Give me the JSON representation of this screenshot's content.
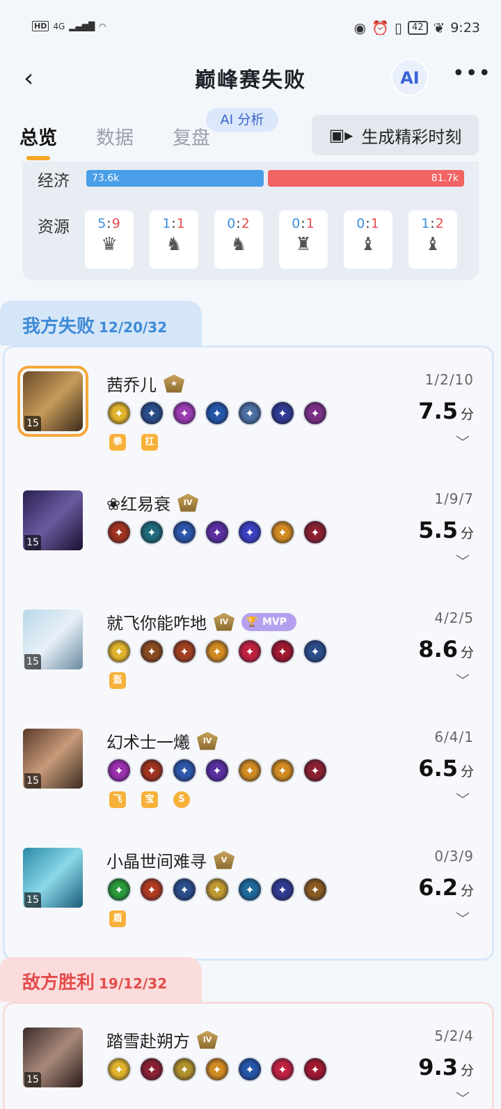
{
  "status": {
    "hd": "HD",
    "network": "4G",
    "battery": "42",
    "time": "9:23"
  },
  "header": {
    "title": "巅峰赛失败",
    "ai_label": "AI"
  },
  "tabs": [
    {
      "label": "总览"
    },
    {
      "label": "数据"
    },
    {
      "label": "复盘"
    }
  ],
  "ai_pill": "AI 分析",
  "highlight_button": "生成精彩时刻",
  "stats": {
    "economy_label": "经济",
    "resource_label": "资源",
    "our_economy": "73.6k",
    "enemy_economy": "81.7k",
    "resources": [
      {
        "ours": "5",
        "theirs": "9",
        "icon": "tyrant-icon"
      },
      {
        "ours": "1",
        "theirs": "1",
        "icon": "dragon-icon"
      },
      {
        "ours": "0",
        "theirs": "2",
        "icon": "storm-dragon-icon"
      },
      {
        "ours": "0",
        "theirs": "1",
        "icon": "overlord-icon"
      },
      {
        "ours": "0",
        "theirs": "1",
        "icon": "shadow-icon"
      },
      {
        "ours": "1",
        "theirs": "2",
        "icon": "fire-icon"
      }
    ]
  },
  "teams": [
    {
      "label": "我方失败",
      "kda": "12/20/32",
      "players": [
        {
          "name": "茜乔儿",
          "level": "15",
          "rank": "★",
          "kda": "1/2/10",
          "score": "7.5",
          "unit": "分",
          "items": [
            "#e0b32a",
            "#2a4d8a",
            "#9b3bb0",
            "#2456a8",
            "#4a6fa0",
            "#2f3a90",
            "#7a2f85"
          ],
          "tags": [
            "拳",
            "扛"
          ],
          "mvp": ""
        },
        {
          "name": "❀红易衰",
          "level": "15",
          "rank": "IV",
          "kda": "1/9/7",
          "score": "5.5",
          "unit": "分",
          "items": [
            "#a0331f",
            "#1f6a7a",
            "#2c56a8",
            "#5a2fa0",
            "#3b3fc0",
            "#d08a20",
            "#8a2030"
          ],
          "tags": [],
          "mvp": ""
        },
        {
          "name": "就飞你能咋地",
          "level": "15",
          "rank": "IV",
          "kda": "4/2/5",
          "score": "8.6",
          "unit": "分",
          "items": [
            "#e0b32a",
            "#8a4a20",
            "#a04020",
            "#d08a20",
            "#c02040",
            "#a01830",
            "#2a4d8a"
          ],
          "tags": [
            "盔"
          ],
          "mvp": "MVP"
        },
        {
          "name": "幻术士一爔",
          "level": "15",
          "rank": "IV",
          "kda": "6/4/1",
          "score": "6.5",
          "unit": "分",
          "items": [
            "#9b2fb0",
            "#a0331f",
            "#2c56a8",
            "#5a2fa0",
            "#d08a20",
            "#d08a20",
            "#8a2030"
          ],
          "tags": [
            "飞",
            "宝",
            "S"
          ],
          "mvp": ""
        },
        {
          "name": "小晶世间难寻",
          "level": "15",
          "rank": "V",
          "kda": "0/3/9",
          "score": "6.2",
          "unit": "分",
          "items": [
            "#2a9a3a",
            "#b03a20",
            "#2a4d8a",
            "#c09a30",
            "#1f6a9a",
            "#2f3a90",
            "#8a5a20"
          ],
          "tags": [
            "盾"
          ],
          "mvp": ""
        }
      ]
    },
    {
      "label": "敌方胜利",
      "kda": "19/12/32",
      "players": [
        {
          "name": "踏雪赴朔方",
          "level": "15",
          "rank": "IV",
          "kda": "5/2/4",
          "score": "9.3",
          "unit": "分",
          "items": [
            "#e0b32a",
            "#8a2030",
            "#b0902a",
            "#d08a20",
            "#2456a8",
            "#c02040",
            "#a01830"
          ],
          "tags": [],
          "mvp": ""
        }
      ]
    }
  ]
}
